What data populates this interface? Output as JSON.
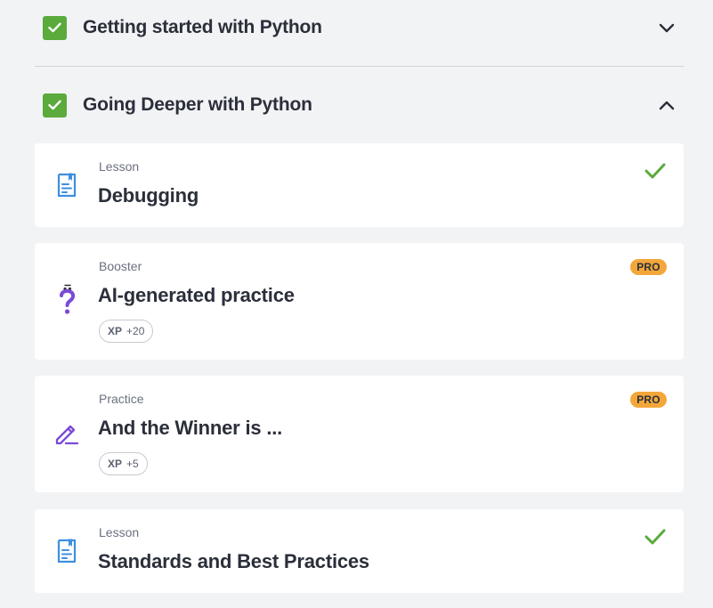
{
  "sections": [
    {
      "title": "Getting started with Python",
      "completed": true,
      "expanded": false,
      "toggle_icon": "chevron-down-icon"
    },
    {
      "title": "Going Deeper with Python",
      "completed": true,
      "expanded": true,
      "toggle_icon": "chevron-up-icon"
    }
  ],
  "items": [
    {
      "type": "Lesson",
      "title": "Debugging",
      "icon": "document-icon",
      "completed": true
    },
    {
      "type": "Booster",
      "title": "AI-generated practice",
      "icon": "question-mark-icon",
      "badge": "PRO",
      "xp_label": "XP",
      "xp_value": "+20"
    },
    {
      "type": "Practice",
      "title": "And the Winner is ...",
      "icon": "pencil-icon",
      "badge": "PRO",
      "xp_label": "XP",
      "xp_value": "+5"
    },
    {
      "type": "Lesson",
      "title": "Standards and Best Practices",
      "icon": "document-icon",
      "completed": true
    }
  ],
  "colors": {
    "background": "#f2f3f5",
    "check_green": "#5aaa3c",
    "pro_orange": "#f3a73b",
    "lesson_blue": "#3d8fe0",
    "practice_purple": "#7b4ad6"
  }
}
